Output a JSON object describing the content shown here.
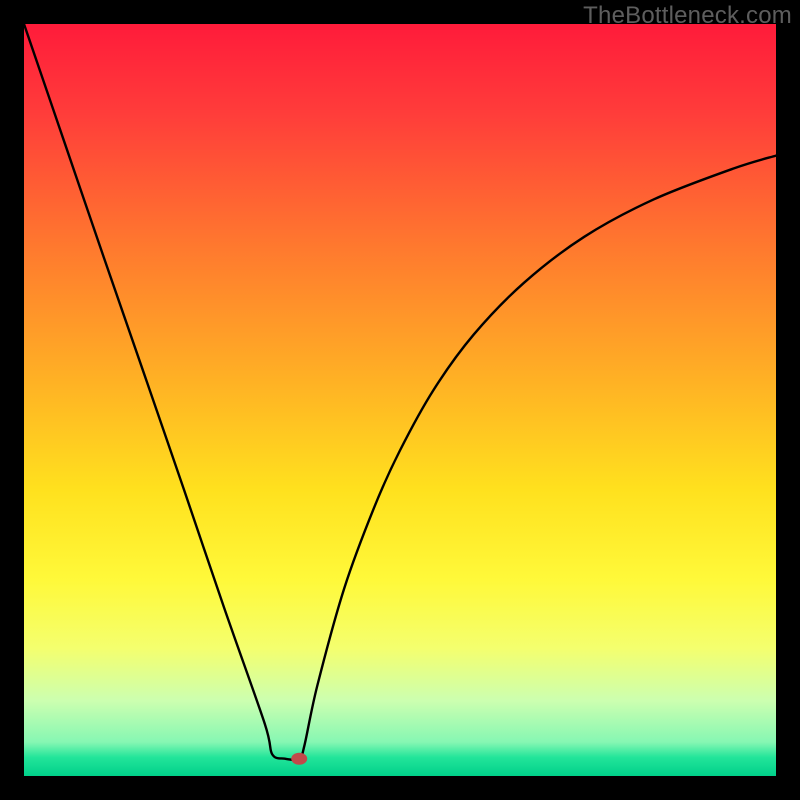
{
  "watermark": "TheBottleneck.com",
  "chart_data": {
    "type": "line",
    "title": "",
    "xlabel": "",
    "ylabel": "",
    "xlim": [
      0,
      100
    ],
    "ylim": [
      0,
      100
    ],
    "gradient_stops": [
      {
        "offset": 0.0,
        "color": "#ff1b3a"
      },
      {
        "offset": 0.12,
        "color": "#ff3d3a"
      },
      {
        "offset": 0.3,
        "color": "#ff7a2e"
      },
      {
        "offset": 0.48,
        "color": "#ffb324"
      },
      {
        "offset": 0.62,
        "color": "#ffe11e"
      },
      {
        "offset": 0.74,
        "color": "#fff93a"
      },
      {
        "offset": 0.83,
        "color": "#f4ff6e"
      },
      {
        "offset": 0.9,
        "color": "#ccffb0"
      },
      {
        "offset": 0.955,
        "color": "#86f7b3"
      },
      {
        "offset": 0.975,
        "color": "#23e59a"
      },
      {
        "offset": 1.0,
        "color": "#00d08a"
      }
    ],
    "series": [
      {
        "name": "curve",
        "x": [
          0,
          5.3,
          10.6,
          16.0,
          21.3,
          26.6,
          32.0,
          33.0,
          34.7,
          36.6,
          37.3,
          39.0,
          42.6,
          46.6,
          50.0,
          54.5,
          59.8,
          66.5,
          74.5,
          83.8,
          94.4,
          100.0
        ],
        "y": [
          100,
          84.5,
          69.0,
          53.4,
          38.0,
          22.4,
          7.0,
          2.9,
          2.3,
          2.3,
          4.1,
          12.0,
          25.0,
          35.8,
          43.3,
          51.4,
          58.7,
          65.6,
          71.7,
          76.7,
          80.8,
          82.5
        ]
      }
    ],
    "marker": {
      "x": 36.6,
      "y": 2.3,
      "color": "#c14a4a"
    }
  }
}
